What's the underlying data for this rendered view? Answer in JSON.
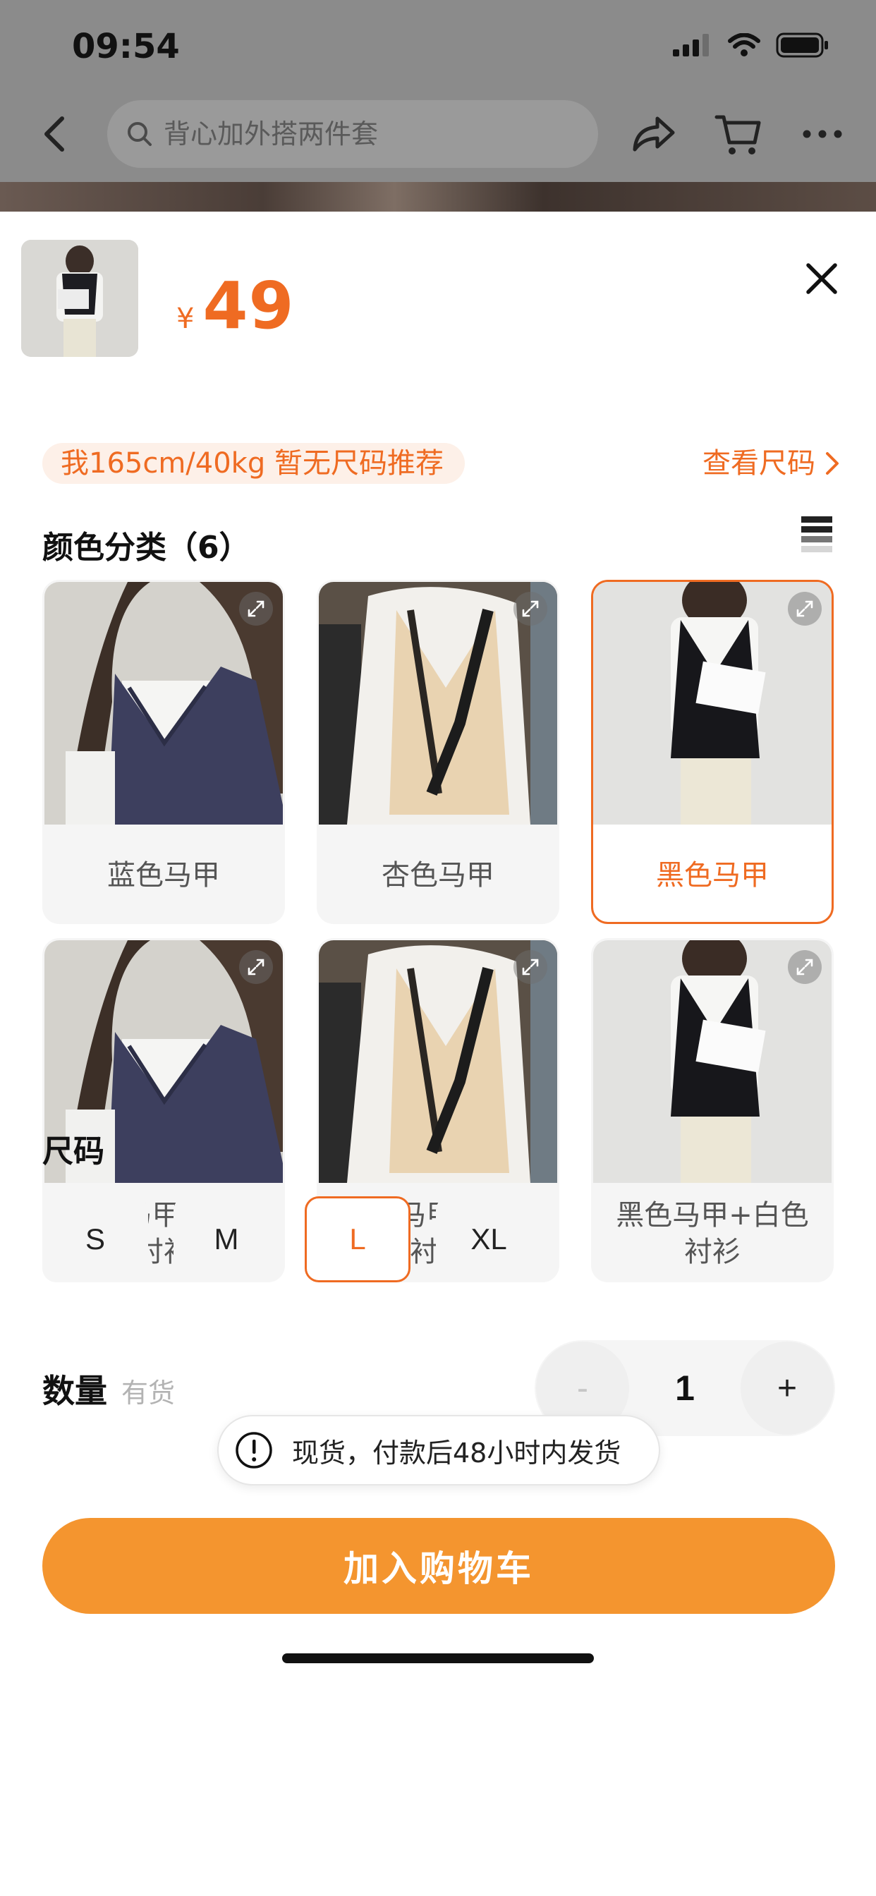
{
  "status_bar": {
    "time": "09:54"
  },
  "nav": {
    "search_placeholder": "背心加外搭两件套"
  },
  "product": {
    "currency": "¥",
    "price": "49"
  },
  "recommendation": {
    "text": "我165cm/40kg 暂无尺码推荐",
    "size_link": "查看尺码"
  },
  "color_section": {
    "title": "颜色分类（6）",
    "items": [
      {
        "label": "蓝色马甲",
        "selected": false
      },
      {
        "label": "杏色马甲",
        "selected": false
      },
      {
        "label": "黑色马甲",
        "selected": true
      },
      {
        "label": "蓝色马甲+白色衬衫",
        "selected": false
      },
      {
        "label": "杏色马甲+白色衬衫",
        "selected": false
      },
      {
        "label": "黑色马甲+白色衬衫",
        "selected": false
      }
    ]
  },
  "size_section": {
    "title": "尺码",
    "options": [
      {
        "label": "S",
        "selected": false
      },
      {
        "label": "M",
        "selected": false
      },
      {
        "label": "L",
        "selected": true
      },
      {
        "label": "XL",
        "selected": false
      }
    ]
  },
  "quantity": {
    "label": "数量",
    "stock": "有货",
    "minus": "-",
    "value": "1",
    "plus": "+"
  },
  "toast": {
    "text": "现货，付款后48小时内发货"
  },
  "cart_button": {
    "label": "加入购物车"
  },
  "colors": {
    "accent": "#ef6b22",
    "cart_button": "#f4952f",
    "chip_bg": "#f5f5f5"
  }
}
